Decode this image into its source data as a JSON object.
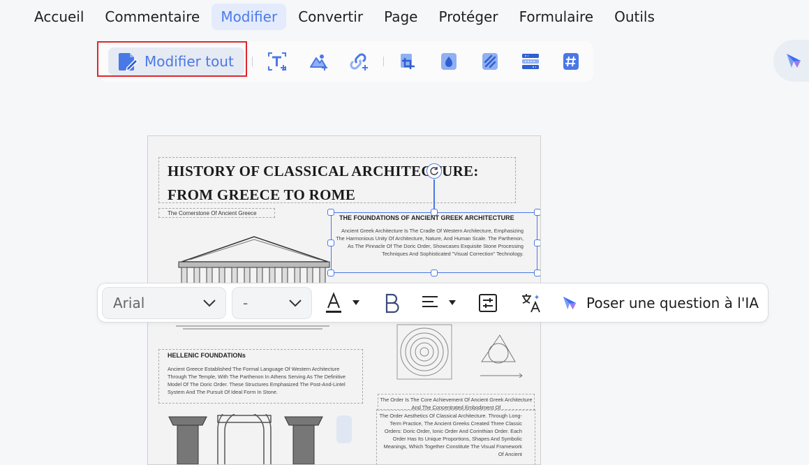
{
  "menu": {
    "items": [
      {
        "label": "Accueil",
        "active": false
      },
      {
        "label": "Commentaire",
        "active": false
      },
      {
        "label": "Modifier",
        "active": true
      },
      {
        "label": "Convertir",
        "active": false
      },
      {
        "label": "Page",
        "active": false
      },
      {
        "label": "Protéger",
        "active": false
      },
      {
        "label": "Formulaire",
        "active": false
      },
      {
        "label": "Outils",
        "active": false
      }
    ]
  },
  "toolbar": {
    "edit_all_label": "Modifier tout",
    "tools": [
      "add-text-icon",
      "add-image-icon",
      "add-link-icon",
      "crop-page-icon",
      "watermark-icon",
      "background-icon",
      "header-footer-icon",
      "bates-number-icon"
    ]
  },
  "colors": {
    "accent": "#4a78e6",
    "highlight_frame": "#e0262b",
    "active_menu_bg": "#e3ebfc"
  },
  "document": {
    "title_line1": "HISTORY OF CLASSICAL ARCHITECTURE:",
    "title_line2": "FROM GREECE TO ROME",
    "subtitle": "The Cornerstone Of Ancient Greece",
    "selected_block": {
      "heading": "THE FOUNDATIONS OF ANCIENT GREEK ARCHITECTURE",
      "body": "Ancient Greek Architecture Is The Cradle Of Western Architecture, Emphasizing The Harmonious Unity Of Architecture, Nature, And Human Scale. The Parthenon, As The Pinnacle Of The Doric Order, Showcases Exquisite Stone Processing Techniques And Sophisticated \"Visual Correction\" Technology."
    },
    "hellenic": {
      "heading": "HELLENIC FOUNDATIONs",
      "body": "Ancient Greece Established The Formal Language Of Western Architecture Through The Temple, With The Parthenon In Athens Serving As The Definitive Model Of The Doric Order. These Structures Emphasized The Post-And-Lintel System And The Pursuit Of Ideal Form In Stone."
    },
    "orders_text_top": "The Order Is The Core Achievement Of Ancient Greek Architecture And The Concentrated Embodiment Of",
    "orders_text_bottom": "The Order Aesthetics Of Classical Architecture. Through Long-Term Practice, The Ancient Greeks Created Three Classic Orders: Doric Order, Ionic Order And Corinthian Order. Each Order Has Its Unique Proportions, Shapes And Symbolic Meanings, Which Together Constitute The Visual Framework Of Ancient"
  },
  "format_toolbar": {
    "font_family": "Arial",
    "font_size": "-",
    "ask_ai_label": "Poser une question à l'IA"
  }
}
